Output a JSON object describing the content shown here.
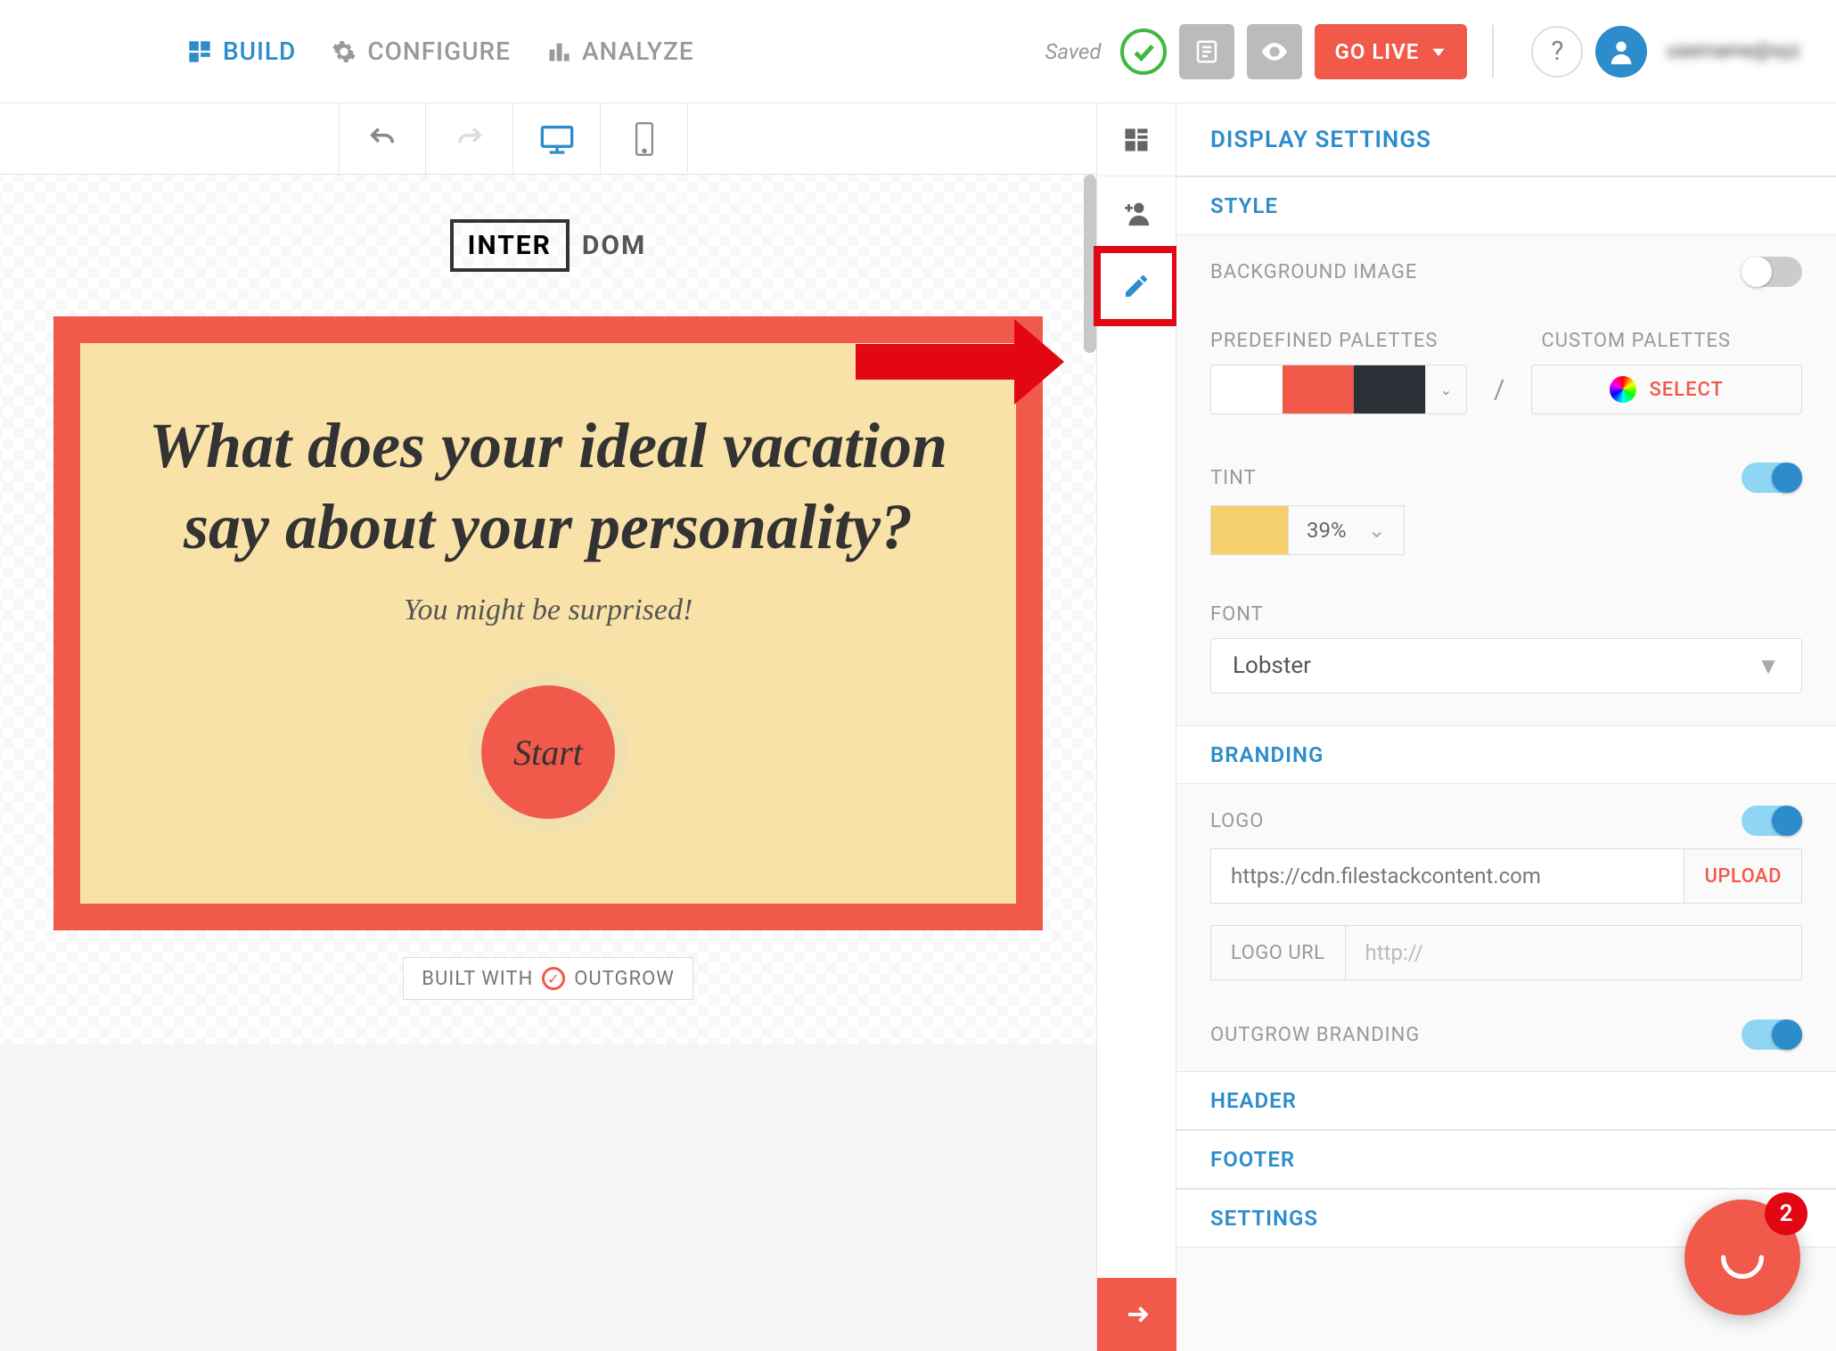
{
  "nav": {
    "build": "BUILD",
    "configure": "CONFIGURE",
    "analyze": "ANALYZE"
  },
  "top": {
    "saved": "Saved",
    "golive": "GO LIVE",
    "help": "?",
    "user": "username@xyz"
  },
  "preview": {
    "logo1": "INTER",
    "logo2": "DOM",
    "title": "What does your ideal vacation say about your personality?",
    "sub": "You might be surprised!",
    "start": "Start",
    "built": "BUILT WITH",
    "built_brand": "OUTGROW"
  },
  "panel": {
    "title": "DISPLAY SETTINGS",
    "style": "STYLE",
    "bg_image": "BACKGROUND IMAGE",
    "pred": "PREDEFINED PALETTES",
    "cust": "CUSTOM PALETTES",
    "select": "SELECT",
    "slash": "/",
    "tint": "TINT",
    "tint_val": "39%",
    "font": "FONT",
    "font_val": "Lobster",
    "branding": "BRANDING",
    "logo": "LOGO",
    "logo_val": "https://cdn.filestackcontent.com",
    "upload": "UPLOAD",
    "logo_url": "LOGO URL",
    "logo_url_ph": "http://",
    "outgrow": "OUTGROW BRANDING",
    "header": "HEADER",
    "footer": "FOOTER",
    "settings": "SETTINGS",
    "pal_colors": [
      "#ffffff",
      "#f15a4a",
      "#2b3036"
    ],
    "tint_color": "#f5cf6c"
  },
  "chat": {
    "count": "2"
  }
}
